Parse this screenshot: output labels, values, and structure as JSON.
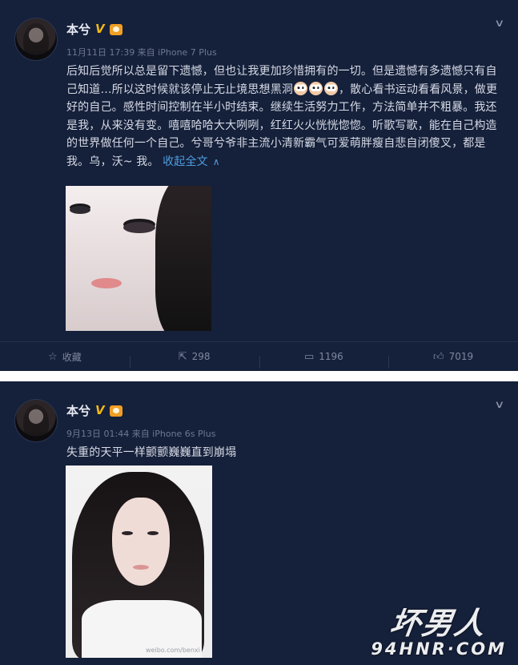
{
  "posts": [
    {
      "author": "本兮",
      "meta": "11月11日 17:39 来自 iPhone 7 Plus",
      "content_parts": [
        "后知后觉所以总是留下遗憾，但也让我更加珍惜拥有的一切。但是遗憾有多遗憾只有自己知道…所以这时候就该停止无止境思想黑洞",
        "，散心看书运动看看风景，做更好的自己。感性时间控制在半小时结束。继续生活努力工作，方法简单并不粗暴。我还是我，从来没有变。嘻嘻哈哈大大咧咧，红红火火恍恍惚惚。听歌写歌，能在自己构造的世界做任何一个自己。兮哥兮爷非主流小清新霸气可爱萌胖瘦自悲自闭傻叉，都是我。乌，沃~ 我。"
      ],
      "expand_link": "收起全文",
      "actions": {
        "favorite": "收藏",
        "repost": "298",
        "comment": "1196",
        "like": "7019"
      }
    },
    {
      "author": "本兮",
      "meta": "9月13日 01:44 来自 iPhone 6s Plus",
      "content": "失重的天平一样颤颤巍巍直到崩塌",
      "photo_watermark": "weibo.com/benxi"
    }
  ],
  "site_watermark": {
    "line1": "坏男人",
    "line2": "94HNR·COM"
  },
  "colors": {
    "card_bg": "#15203a",
    "text": "#d6dae6",
    "meta": "#6d7893",
    "link": "#4e9de0",
    "badge": "#f2b718"
  },
  "icons": [
    "chevron-down-icon",
    "verified-v-icon",
    "medal-icon",
    "star-icon",
    "repost-icon",
    "comment-icon",
    "like-icon",
    "chevron-up-icon",
    "emoji-icon"
  ]
}
